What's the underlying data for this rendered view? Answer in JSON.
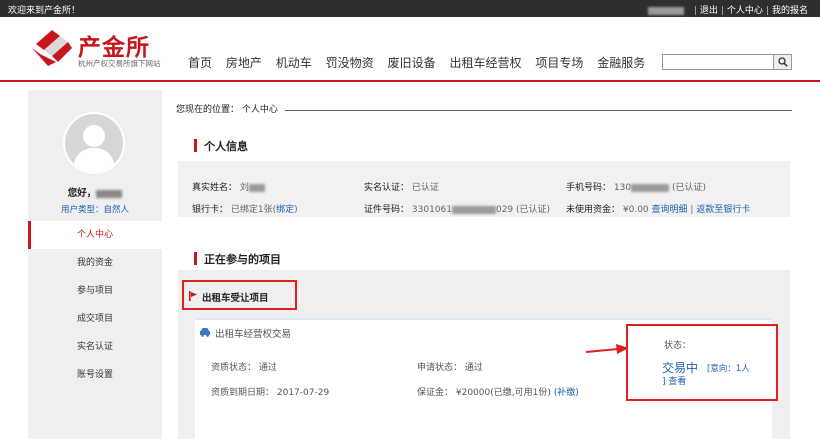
{
  "topbar": {
    "welcome": "欢迎来到产金所！",
    "logout": "退出",
    "user_center": "个人中心",
    "my_signup": "我的报名"
  },
  "header": {
    "logo_name": "产金所",
    "logo_slogan": "杭州产权交易所旗下网站",
    "nav": [
      "首页",
      "房地产",
      "机动车",
      "罚没物资",
      "废旧设备",
      "出租车经营权",
      "项目专场",
      "金融服务"
    ],
    "search_placeholder": ""
  },
  "colors": {
    "brand_red": "#c8161d",
    "link_blue": "#1d5fb0",
    "highlight_red": "#e02020"
  },
  "sidebar": {
    "greeting_prefix": "您好，",
    "user_type": "用户类型：自然人",
    "menu": [
      "个人中心",
      "我的资金",
      "参与项目",
      "成交项目",
      "实名认证",
      "账号设置"
    ],
    "active_index": 0
  },
  "breadcrumb": "您现在的位置： 个人中心",
  "personal_info": {
    "title": "个人信息",
    "real_name_label": "真实姓名：",
    "real_name_value": "刘",
    "verify_label": "实名认证：",
    "verify_value": "已认证",
    "phone_label": "手机号码：",
    "phone_prefix": "130",
    "phone_suffix": "(已认证)",
    "bank_label": "银行卡：",
    "bank_value": "已绑定1张(",
    "bank_link": "绑定",
    "bank_close": ")",
    "id_label": "证件号码：",
    "id_prefix": "3301061",
    "id_suffix": "029 (已认证)",
    "funds_label": "未使用资金：",
    "funds_value": "¥0.00",
    "funds_link1": "查询明细",
    "funds_sep": "|",
    "funds_link2": "返款至银行卡"
  },
  "projects": {
    "title": "正在参与的项目",
    "tab_label": "出租车受让项目",
    "card": {
      "title": "出租车经营权交易",
      "qual_status": "资质状态：  通过",
      "apply_status": "申请状态：  通过",
      "qual_expire": "资质到期日期：  2017-07-29",
      "deposit": "保证金：  ¥20000(已缴,可用1份)",
      "deposit_link": "(补缴)",
      "status_label": "状态：",
      "status_value": "交易中",
      "intent": "[意向：1人",
      "view": "] 查看"
    }
  }
}
